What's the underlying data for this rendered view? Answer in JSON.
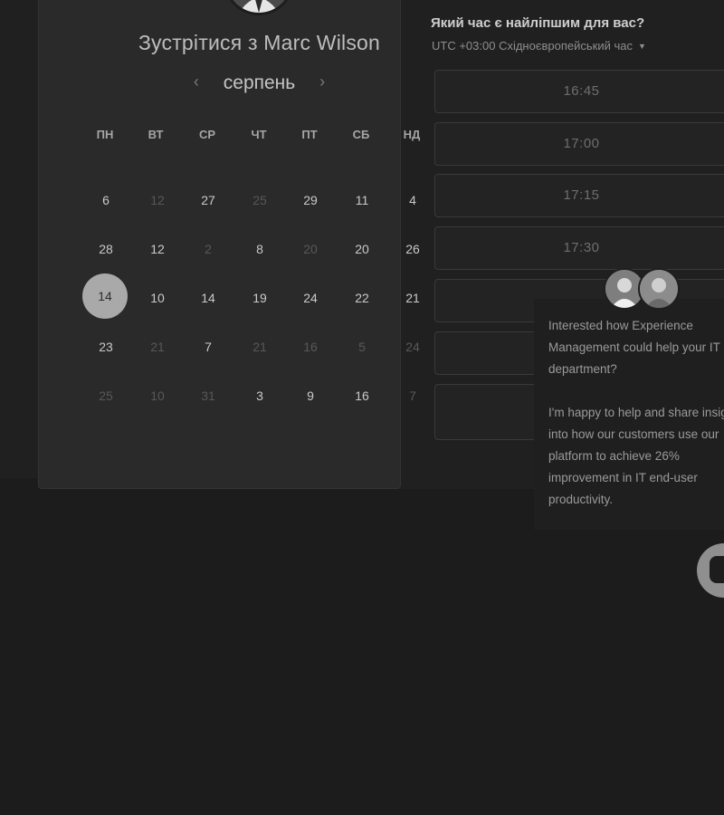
{
  "scheduler": {
    "title": "Зустрітися з Marc Wilson",
    "month": "серпень",
    "prev_icon": "‹",
    "next_icon": "›",
    "weekdays": [
      "ПН",
      "ВТ",
      "СР",
      "ЧТ",
      "ПТ",
      "СБ",
      "НД"
    ],
    "days": [
      [
        "6",
        "12",
        "27",
        "25",
        "29",
        "11",
        "4"
      ],
      [
        "28",
        "12",
        "2",
        "8",
        "20",
        "20",
        "26"
      ],
      [
        "14",
        "10",
        "14",
        "19",
        "24",
        "22",
        "21"
      ],
      [
        "23",
        "21",
        "7",
        "21",
        "16",
        "5",
        "24"
      ],
      [
        "25",
        "10",
        "31",
        "3",
        "9",
        "16",
        "7"
      ]
    ],
    "selected_day": "14"
  },
  "times": {
    "question": "Який час є найліпшим для вас?",
    "timezone": "UTC +03:00 Східноєвропейський час",
    "slots": [
      "16:45",
      "17:00",
      "17:15",
      "17:30",
      "",
      "",
      ""
    ]
  },
  "chat": {
    "message": "Interested how Experience Management could help your IT department?\n\nI'm happy to help and share insight into how our customers use our platform to achieve 26% improvement in IT end-user productivity."
  },
  "colors": {
    "background": "#1c1c1d",
    "card": "#2a2a2b",
    "selected": "#a9a9a9"
  }
}
